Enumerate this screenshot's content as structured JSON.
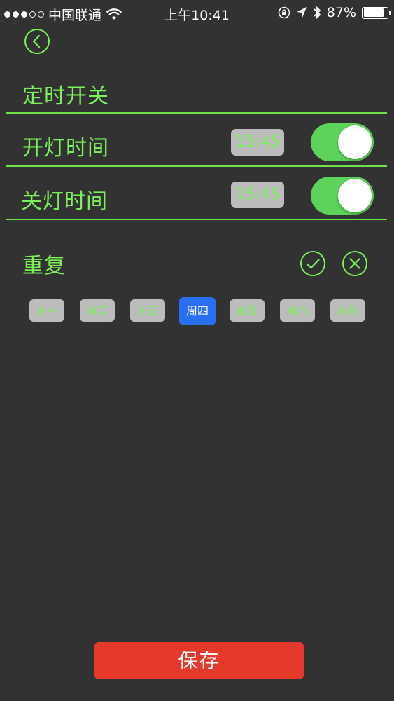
{
  "status_bar": {
    "carrier": "中国联通",
    "time": "上午10:41",
    "battery_text": "87%",
    "battery_level": 0.87
  },
  "header": {
    "back_icon": "chevron-left-circle-icon"
  },
  "section": {
    "title": "定时开关"
  },
  "rows": [
    {
      "label": "开灯时间",
      "time": "15:45",
      "enabled": true
    },
    {
      "label": "关灯时间",
      "time": "15:45",
      "enabled": true
    }
  ],
  "repeat": {
    "label": "重复",
    "confirm_icon": "check-circle-icon",
    "cancel_icon": "close-circle-icon",
    "days": [
      "周一",
      "周二",
      "周三",
      "周四",
      "周五",
      "周六",
      "周日"
    ],
    "selected_index": 3
  },
  "footer": {
    "save_label": "保存"
  },
  "colors": {
    "accent_green": "#7bf05a",
    "toggle_on": "#5ed35c",
    "selected_blue": "#2a6ff0",
    "save_red": "#e6392c",
    "background": "#323232"
  }
}
